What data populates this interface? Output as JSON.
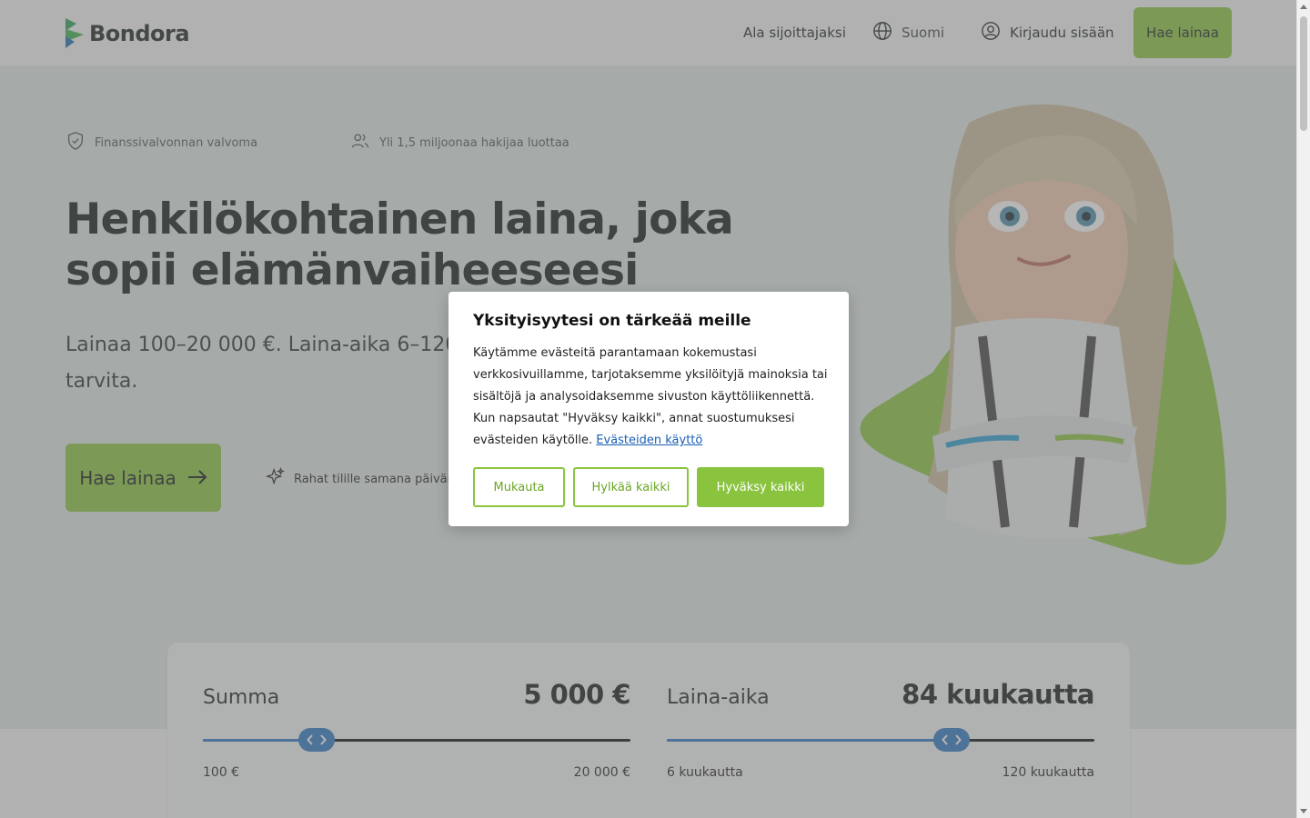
{
  "header": {
    "logo_text": "Bondora",
    "nav_investor": "Ala sijoittajaksi",
    "nav_language": "Suomi",
    "nav_login": "Kirjaudu sisään",
    "apply_button": "Hae lainaa"
  },
  "hero": {
    "badge_regulated": "Finanssivalvonnan valvoma",
    "badge_trusted": "Yli 1,5 miljoonaa hakijaa luottaa",
    "title": "Henkilökohtainen laina, joka sopii elämänvaiheeseesi",
    "subtitle": "Lainaa 100–20 000 €. Laina-aika 6–120 kuukautta. Vakuutta ei tarvita.",
    "cta_label": "Hae lainaa",
    "same_day_text": "Rahat tilille samana päivänä"
  },
  "calculator": {
    "amount": {
      "label": "Summa",
      "value_text": "5 000 €",
      "value": 5000,
      "min": 100,
      "max": 20000,
      "min_label": "100 €",
      "max_label": "20 000 €",
      "position_fraction": 0.265
    },
    "term": {
      "label": "Laina-aika",
      "value_text": "84 kuukautta",
      "value": 84,
      "min": 6,
      "max": 120,
      "min_label": "6 kuukautta",
      "max_label": "120 kuukautta",
      "position_fraction": 0.667
    }
  },
  "cookie_modal": {
    "title": "Yksityisyytesi on tärkeää meille",
    "body": "Käytämme evästeitä parantamaan kokemustasi verkkosivuillamme, tarjotaksemme yksilöityjä mainoksia tai sisältöjä ja analysoidaksemme sivuston käyttöliikennettä. Kun napsautat \"Hyväksy kaikki\", annat suostumuksesi evästeiden käytölle.",
    "link_text": "Evästeiden käyttö",
    "customize_button": "Mukauta",
    "reject_button": "Hylkää kaikki",
    "accept_button": "Hyväksy kaikki"
  },
  "colors": {
    "brand_green": "#8ac43f",
    "slider_blue": "#2f78c4",
    "link_blue": "#1a5fb4"
  }
}
